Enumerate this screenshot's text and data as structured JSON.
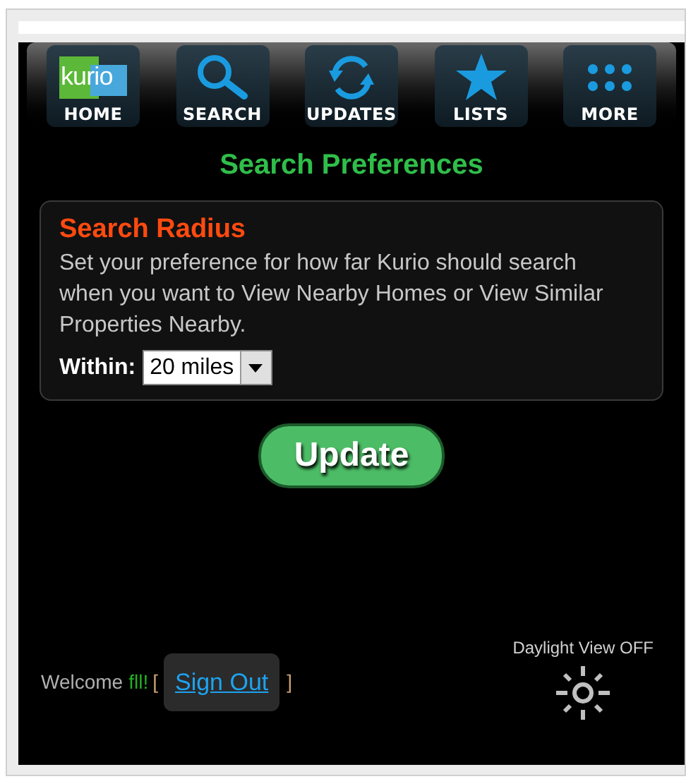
{
  "nav": [
    {
      "kind": "logo",
      "logo_text": "kurio",
      "label": "HOME"
    },
    {
      "kind": "search",
      "label": "SEARCH"
    },
    {
      "kind": "refresh",
      "label": "UPDATES"
    },
    {
      "kind": "star",
      "label": "LISTS"
    },
    {
      "kind": "grid",
      "label": "MORE"
    }
  ],
  "title": "Search Preferences",
  "card": {
    "heading": "Search Radius",
    "description": "Set your preference for how far Kurio should search when you want to View Nearby Homes or View Similar Properties Nearby.",
    "field_label": "Within:",
    "select_value": "20 miles"
  },
  "update_button": "Update",
  "footer": {
    "welcome": "Welcome",
    "user": "fll!",
    "open_bracket": "[",
    "sign_out": "Sign Out",
    "close_bracket": "]",
    "daylight": "Daylight View OFF"
  }
}
